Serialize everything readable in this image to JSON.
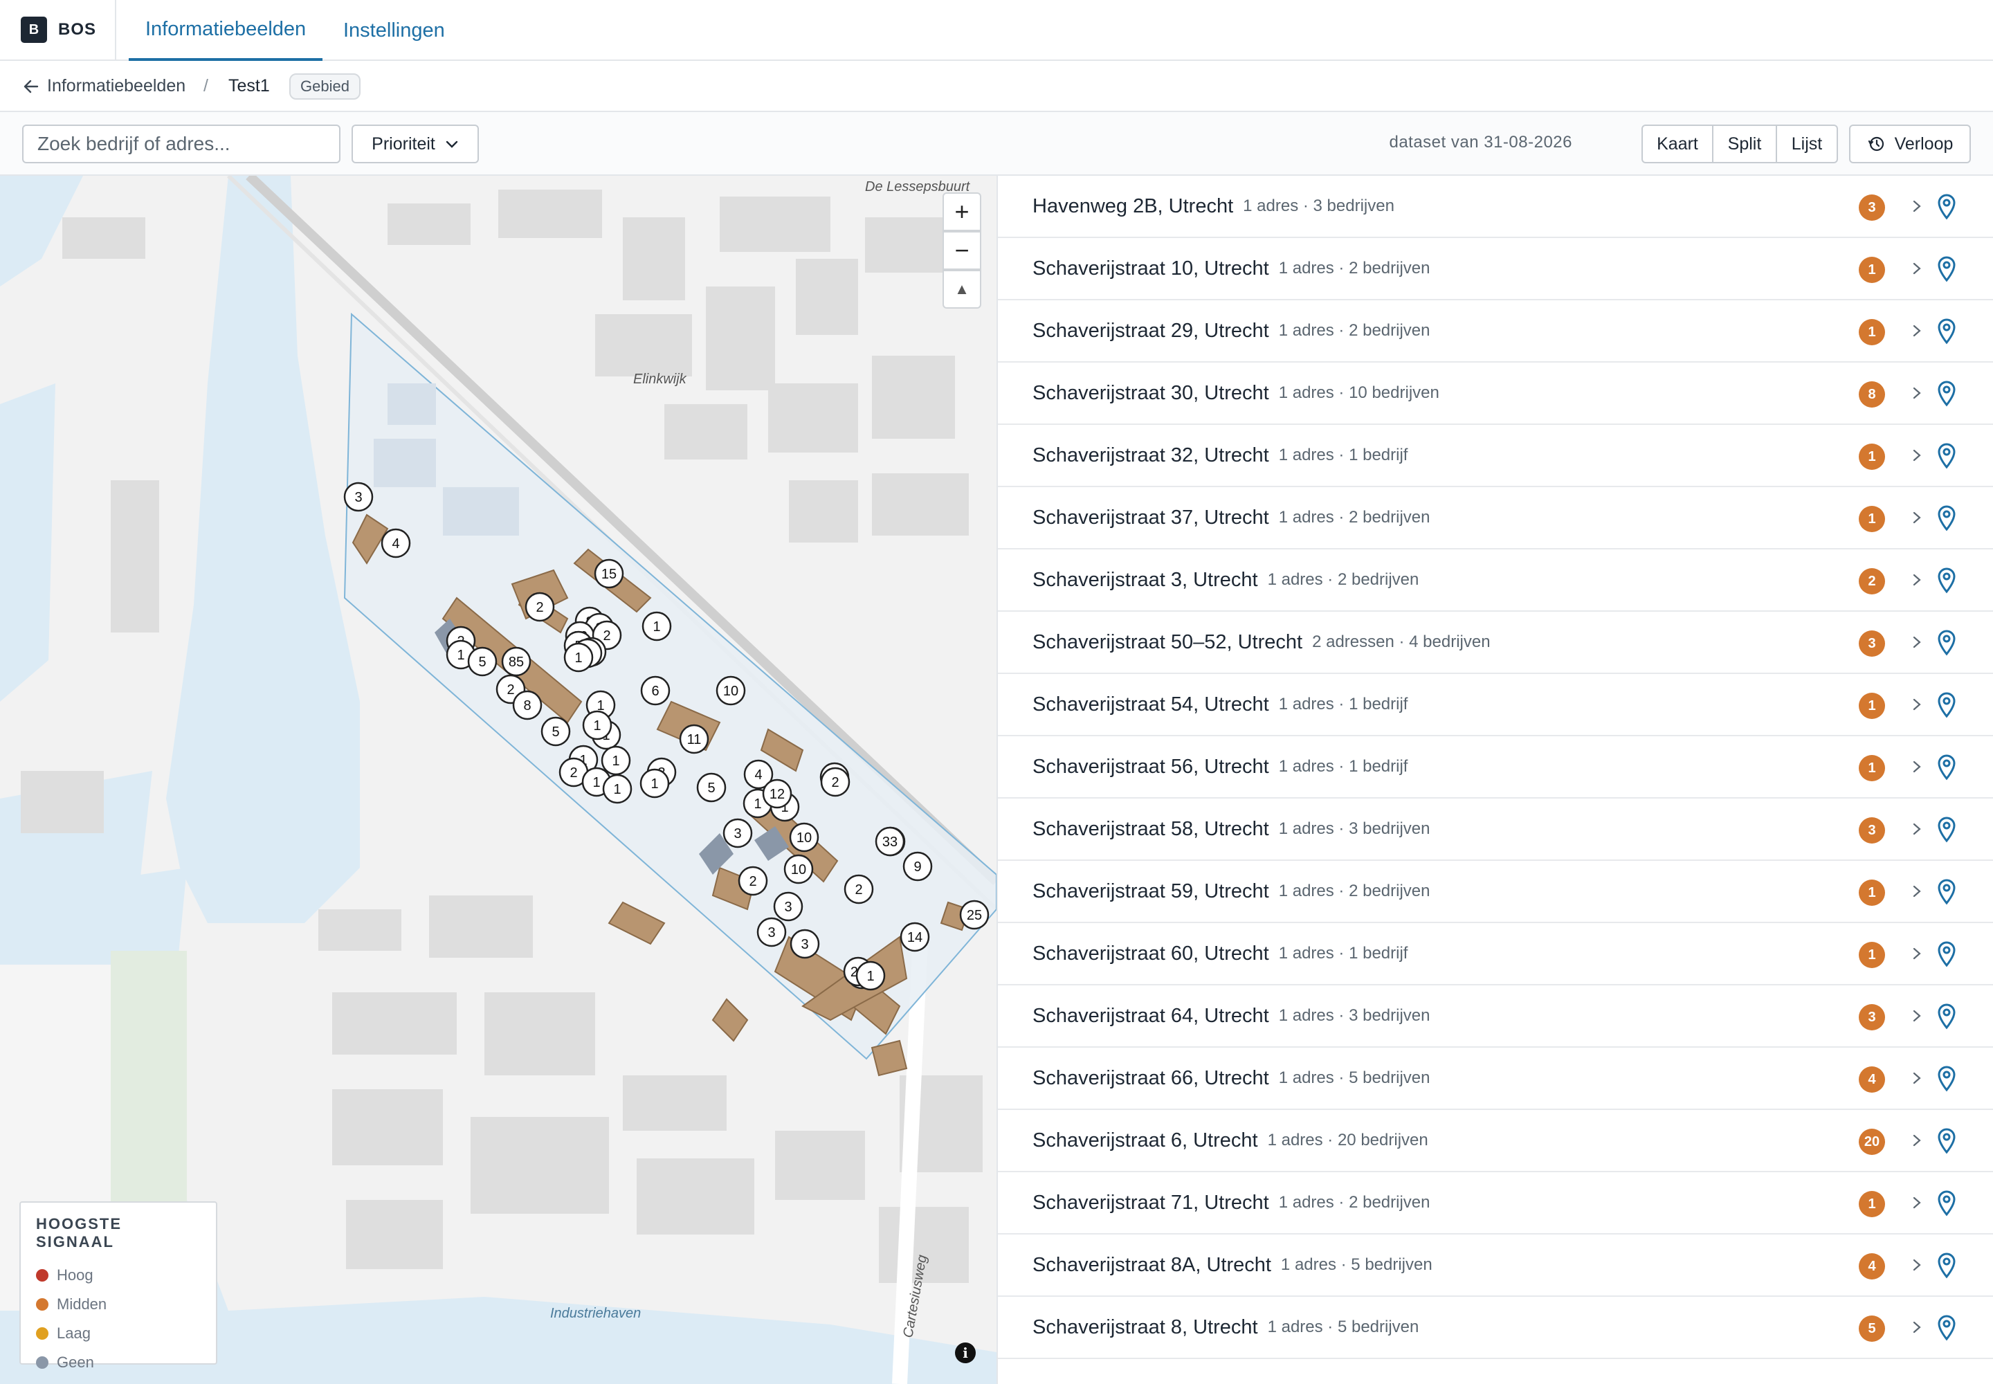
{
  "brand": {
    "logo": "B",
    "name": "BOS"
  },
  "nav": {
    "tabs": [
      {
        "label": "Informatiebeelden",
        "active": true
      },
      {
        "label": "Instellingen",
        "active": false
      }
    ]
  },
  "breadcrumb": {
    "back_label": "Informatiebeelden",
    "separator": "/",
    "current": "Test1",
    "badge": "Gebied"
  },
  "toolbar": {
    "search_placeholder": "Zoek bedrijf of adres...",
    "priority_label": "Prioriteit",
    "dataset_label": "dataset van 31-08-2026",
    "view_options": [
      "Kaart",
      "Split",
      "Lijst"
    ],
    "history_label": "Verloop"
  },
  "map": {
    "labels": [
      "De Lessepsbuurt",
      "Elinkwijk",
      "Industriehaven",
      "Cartesiusweg"
    ],
    "zoom_in": "+",
    "zoom_out": "−",
    "compass": "▲",
    "info": "i",
    "markers": [
      "3",
      "4",
      "15",
      "2",
      "1",
      "8",
      "3",
      "20",
      "2",
      "5",
      "2",
      "1",
      "2",
      "85",
      "1",
      "5",
      "2",
      "6",
      "8",
      "1",
      "10",
      "1",
      "1",
      "5",
      "11",
      "1",
      "1",
      "1",
      "2",
      "1",
      "3",
      "1",
      "1",
      "5",
      "4",
      "1",
      "1",
      "10",
      "2",
      "1",
      "12",
      "33",
      "3",
      "3",
      "2",
      "10",
      "33",
      "9",
      "2",
      "3",
      "3",
      "14",
      "25",
      "3",
      "23",
      "1"
    ]
  },
  "legend": {
    "title": "HOOGSTE SIGNAAL",
    "items": [
      {
        "label": "Hoog",
        "color": "#c0392b"
      },
      {
        "label": "Midden",
        "color": "#d4782f"
      },
      {
        "label": "Laag",
        "color": "#e0a020"
      },
      {
        "label": "Geen",
        "color": "#8a97a8"
      }
    ]
  },
  "accent": "#1d6fa5",
  "badge_color": "#d4782f",
  "addresses": [
    {
      "name": "Havenweg 2B, Utrecht",
      "meta": "1 adres · 3 bedrijven",
      "count": "3"
    },
    {
      "name": "Schaverijstraat 10, Utrecht",
      "meta": "1 adres · 2 bedrijven",
      "count": "1"
    },
    {
      "name": "Schaverijstraat 29, Utrecht",
      "meta": "1 adres · 2 bedrijven",
      "count": "1"
    },
    {
      "name": "Schaverijstraat 30, Utrecht",
      "meta": "1 adres · 10 bedrijven",
      "count": "8"
    },
    {
      "name": "Schaverijstraat 32, Utrecht",
      "meta": "1 adres · 1 bedrijf",
      "count": "1"
    },
    {
      "name": "Schaverijstraat 37, Utrecht",
      "meta": "1 adres · 2 bedrijven",
      "count": "1"
    },
    {
      "name": "Schaverijstraat 3, Utrecht",
      "meta": "1 adres · 2 bedrijven",
      "count": "2"
    },
    {
      "name": "Schaverijstraat 50–52, Utrecht",
      "meta": "2 adressen · 4 bedrijven",
      "count": "3"
    },
    {
      "name": "Schaverijstraat 54, Utrecht",
      "meta": "1 adres · 1 bedrijf",
      "count": "1"
    },
    {
      "name": "Schaverijstraat 56, Utrecht",
      "meta": "1 adres · 1 bedrijf",
      "count": "1"
    },
    {
      "name": "Schaverijstraat 58, Utrecht",
      "meta": "1 adres · 3 bedrijven",
      "count": "3"
    },
    {
      "name": "Schaverijstraat 59, Utrecht",
      "meta": "1 adres · 2 bedrijven",
      "count": "1"
    },
    {
      "name": "Schaverijstraat 60, Utrecht",
      "meta": "1 adres · 1 bedrijf",
      "count": "1"
    },
    {
      "name": "Schaverijstraat 64, Utrecht",
      "meta": "1 adres · 3 bedrijven",
      "count": "3"
    },
    {
      "name": "Schaverijstraat 66, Utrecht",
      "meta": "1 adres · 5 bedrijven",
      "count": "4"
    },
    {
      "name": "Schaverijstraat 6, Utrecht",
      "meta": "1 adres · 20 bedrijven",
      "count": "20"
    },
    {
      "name": "Schaverijstraat 71, Utrecht",
      "meta": "1 adres · 2 bedrijven",
      "count": "1"
    },
    {
      "name": "Schaverijstraat 8A, Utrecht",
      "meta": "1 adres · 5 bedrijven",
      "count": "4"
    },
    {
      "name": "Schaverijstraat 8, Utrecht",
      "meta": "1 adres · 5 bedrijven",
      "count": "5"
    }
  ]
}
